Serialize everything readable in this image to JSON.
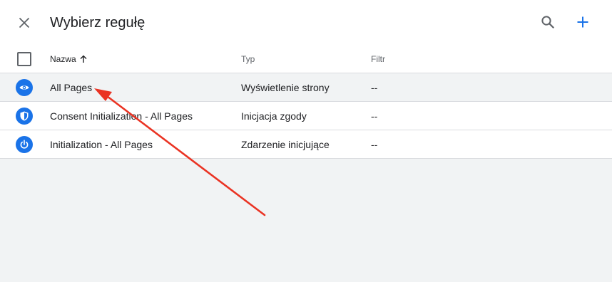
{
  "header": {
    "title": "Wybierz regułę",
    "icons": {
      "close": "close-icon",
      "search": "search-icon",
      "add": "plus-icon"
    },
    "accent_color": "#1a73e8"
  },
  "table": {
    "columns": {
      "name": "Nazwa",
      "type": "Typ",
      "filter": "Filtr"
    },
    "sort_icon": "arrow-up-icon",
    "rows": [
      {
        "name": "All Pages",
        "type": "Wyświetlenie strony",
        "filter": "--",
        "icon": "eye-icon"
      },
      {
        "name": "Consent Initialization - All Pages",
        "type": "Inicjacja zgody",
        "filter": "--",
        "icon": "shield-icon"
      },
      {
        "name": "Initialization - All Pages",
        "type": "Zdarzenie inicjujące",
        "filter": "--",
        "icon": "power-icon"
      }
    ]
  },
  "annotation": {
    "color": "#ea3323",
    "icon": "red-arrow-annotation"
  }
}
